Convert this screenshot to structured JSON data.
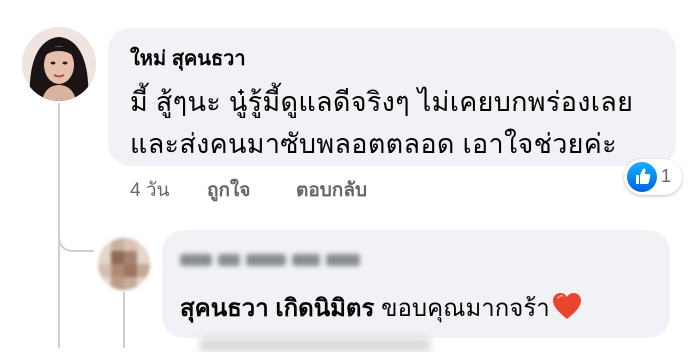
{
  "comment": {
    "author": "ใหม่ สุคนธวา",
    "text_lines": [
      "มี้ สู้ๆนะ นู๋รู้มี้ดูแลดีจริงๆ ไม่เคยบกพร่องเลย",
      "และส่งคนมาซับพลอตตลอด เอาใจช่วยค่ะ"
    ],
    "time": "4 วัน",
    "like_label": "ถูกใจ",
    "reply_label": "ตอบกลับ",
    "reaction_icon": "like-icon",
    "reaction_count": "1"
  },
  "reply": {
    "mention": "สุคนธวา เกิดนิมิตร",
    "text": " ขอบคุณมากจร้า",
    "emoji_icon": "heart-icon"
  },
  "colors": {
    "bubble": "#f0f2f5",
    "secondary_text": "#65676b",
    "like_blue": "#0866ff",
    "heart": "#e8452c"
  }
}
